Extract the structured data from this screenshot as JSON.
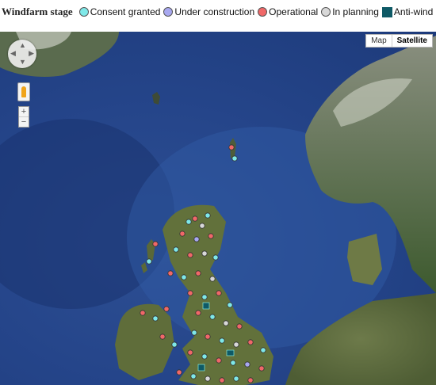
{
  "legend": {
    "title": "Windfarm stage",
    "items": [
      {
        "label": "Consent granted",
        "color": "#7fe8e8",
        "shape": "circle"
      },
      {
        "label": "Under construction",
        "color": "#a8a8f0",
        "shape": "circle"
      },
      {
        "label": "Operational",
        "color": "#f06868",
        "shape": "circle"
      },
      {
        "label": "In planning",
        "color": "#d8d8d8",
        "shape": "circle"
      },
      {
        "label": "Anti-wind MP",
        "color": "#0e5a66",
        "shape": "square"
      }
    ]
  },
  "map_controls": {
    "map_label": "Map",
    "satellite_label": "Satellite",
    "active_type": "Satellite",
    "zoom_in": "+",
    "zoom_out": "−",
    "pan_icon": "pan-control-icon",
    "pegman_icon": "street-view-pegman-icon"
  }
}
